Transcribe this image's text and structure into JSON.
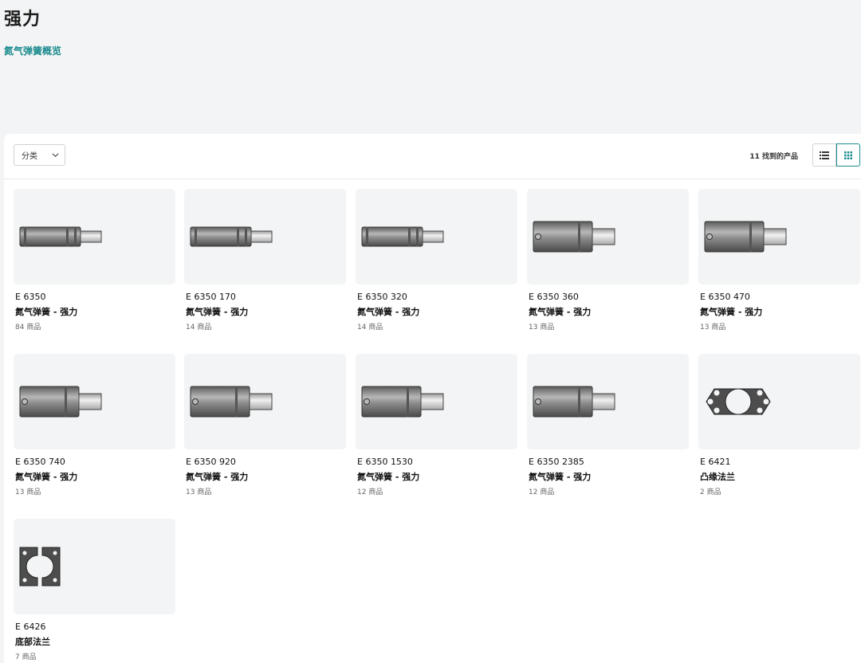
{
  "page": {
    "title": "强力",
    "overview_link": "氮气弹簧概览"
  },
  "toolbar": {
    "category_label": "分类",
    "results_count": "11",
    "results_label": "找到的产品"
  },
  "products": [
    {
      "code": "E 6350",
      "type": "氮气弹簧 - 强力",
      "count": "84 商品",
      "image": "spring-slim"
    },
    {
      "code": "E 6350 170",
      "type": "氮气弹簧 - 强力",
      "count": "14 商品",
      "image": "spring-slim"
    },
    {
      "code": "E 6350 320",
      "type": "氮气弹簧 - 强力",
      "count": "14 商品",
      "image": "spring-slim"
    },
    {
      "code": "E 6350 360",
      "type": "氮气弹簧 - 强力",
      "count": "13 商品",
      "image": "spring-wide"
    },
    {
      "code": "E 6350 470",
      "type": "氮气弹簧 - 强力",
      "count": "13 商品",
      "image": "spring-wide"
    },
    {
      "code": "E 6350 740",
      "type": "氮气弹簧 - 强力",
      "count": "13 商品",
      "image": "spring-wide"
    },
    {
      "code": "E 6350 920",
      "type": "氮气弹簧 - 强力",
      "count": "13 商品",
      "image": "spring-wide"
    },
    {
      "code": "E 6350 1530",
      "type": "氮气弹簧 - 强力",
      "count": "12 商品",
      "image": "spring-wide"
    },
    {
      "code": "E 6350 2385",
      "type": "氮气弹簧 - 强力",
      "count": "12 商品",
      "image": "spring-wide"
    },
    {
      "code": "E 6421",
      "type": "凸缘法兰",
      "count": "2 商品",
      "image": "flange-ring"
    },
    {
      "code": "E 6426",
      "type": "底部法兰",
      "count": "7 商品",
      "image": "flange-split"
    }
  ],
  "colors": {
    "accent": "#1a8b8f",
    "panel_bg": "#ffffff",
    "page_bg": "#f3f4f5"
  }
}
